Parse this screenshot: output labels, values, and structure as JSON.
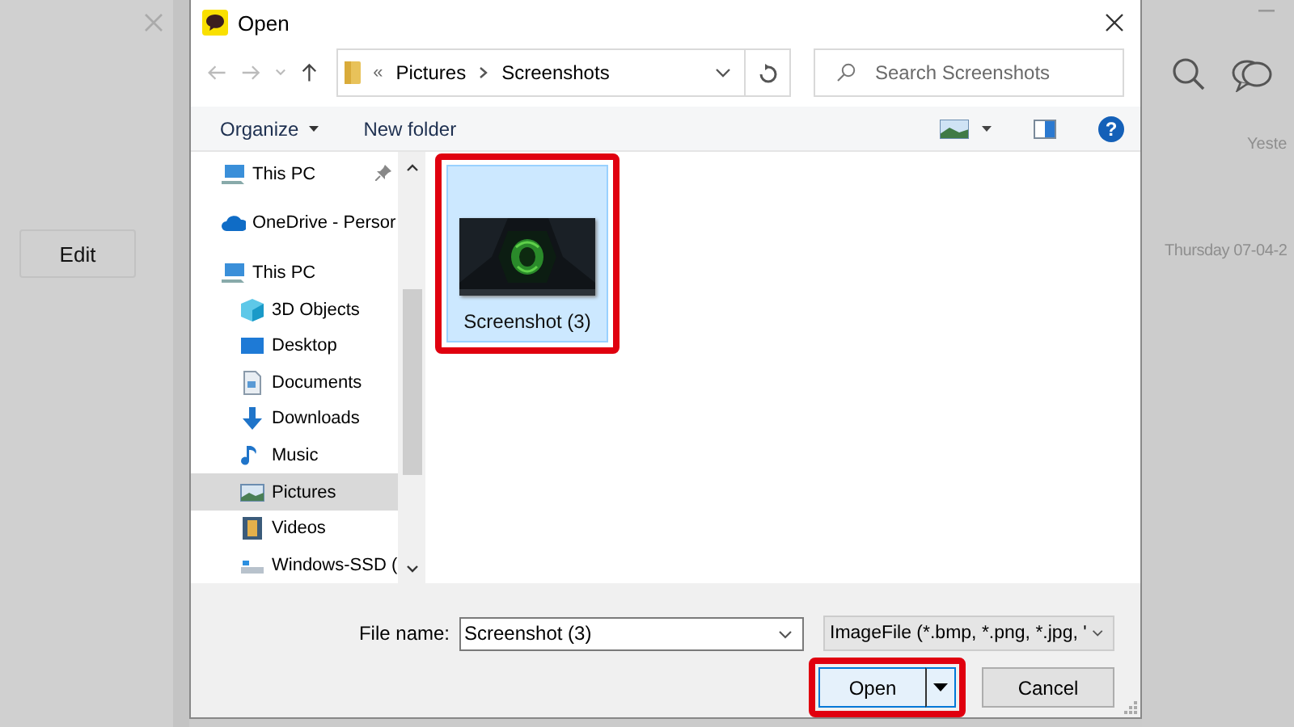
{
  "background_app": {
    "edit_button": "Edit",
    "dates": [
      "Yeste",
      "Thursday 07-04-2"
    ]
  },
  "dialog": {
    "title": "Open",
    "address": {
      "overflow_glyph": "«",
      "path": [
        "Pictures",
        "Screenshots"
      ]
    },
    "search": {
      "placeholder": "Search Screenshots"
    },
    "help_glyph": "?",
    "toolbar": [
      {
        "label": "Organize",
        "dropdown": true
      },
      {
        "label": "New folder",
        "dropdown": false
      }
    ],
    "nav": [
      {
        "label": "This PC",
        "kind": "pc",
        "pinned": true,
        "selected": false
      },
      {
        "label": "OneDrive - Persor",
        "kind": "cloud",
        "pinned": false,
        "selected": false
      },
      {
        "label": "This PC",
        "kind": "pc",
        "pinned": false,
        "selected": false,
        "children": [
          {
            "label": "3D Objects",
            "kind": "cube",
            "pinned": false,
            "selected": false
          },
          {
            "label": "Desktop",
            "kind": "desktop",
            "pinned": false,
            "selected": false
          },
          {
            "label": "Documents",
            "kind": "document",
            "pinned": false,
            "selected": false
          },
          {
            "label": "Downloads",
            "kind": "download",
            "pinned": false,
            "selected": false
          },
          {
            "label": "Music",
            "kind": "music",
            "pinned": false,
            "selected": false
          },
          {
            "label": "Pictures",
            "kind": "pictures",
            "pinned": false,
            "selected": true
          },
          {
            "label": "Videos",
            "kind": "videos",
            "pinned": false,
            "selected": false
          },
          {
            "label": "Windows-SSD (",
            "kind": "drive",
            "pinned": false,
            "selected": false
          }
        ]
      }
    ],
    "files": [
      {
        "name": "Screenshot (3)",
        "kind": "picture",
        "selected": true,
        "highlighted": true
      }
    ],
    "file_name": {
      "label": "File name:",
      "value": "Screenshot (3)"
    },
    "file_type": {
      "value": "ImageFile (*.bmp, *.png, *.jpg, '"
    },
    "buttons": [
      {
        "label": "Open",
        "kind": "split",
        "highlighted": true
      },
      {
        "label": "Cancel",
        "kind": "plain",
        "highlighted": false
      }
    ]
  }
}
